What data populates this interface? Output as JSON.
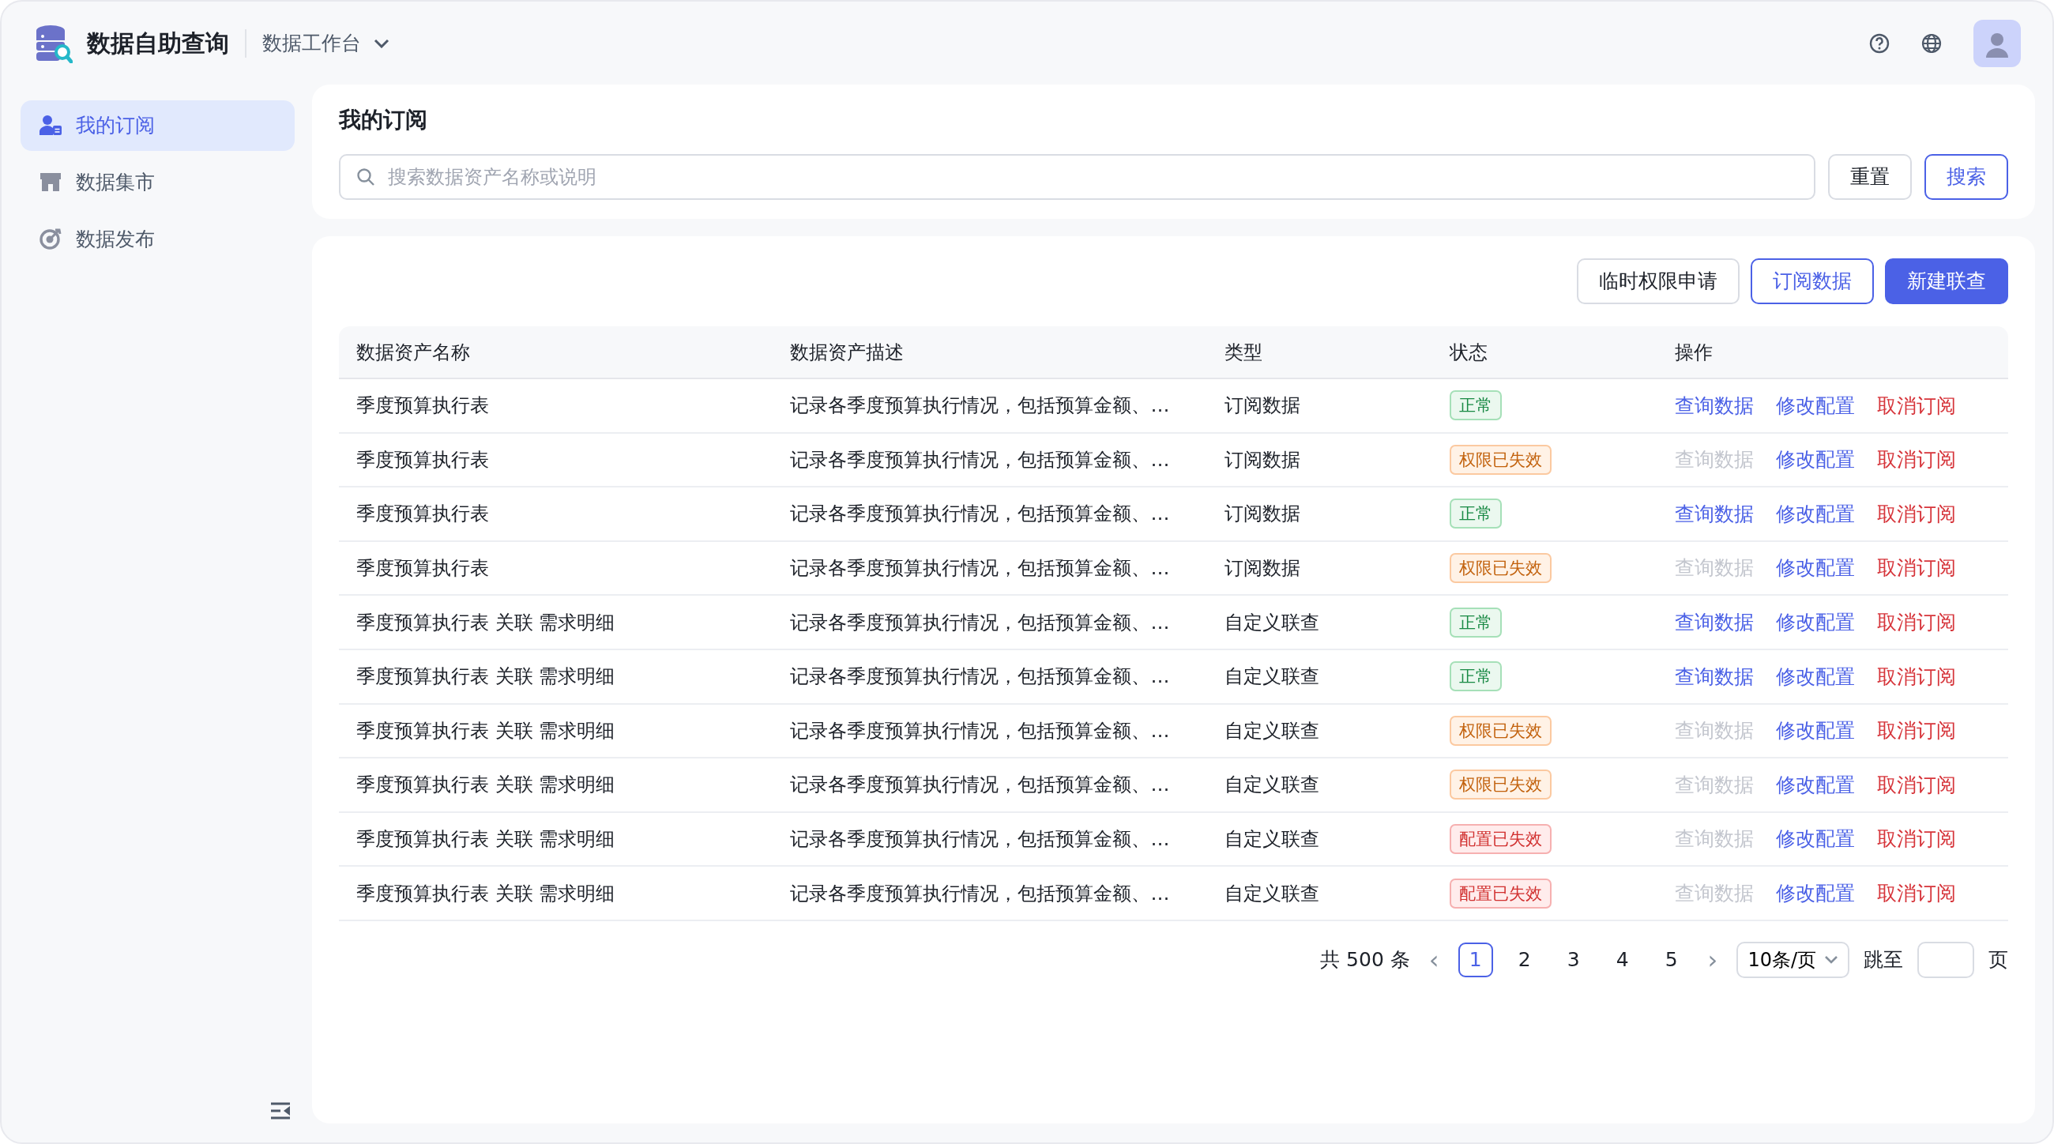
{
  "app": {
    "title": "数据自助查询",
    "workspace": "数据工作台"
  },
  "sidebar": {
    "items": [
      {
        "label": "我的订阅",
        "selected": true,
        "kind": "subscribe"
      },
      {
        "label": "数据集市",
        "selected": false,
        "kind": "market"
      },
      {
        "label": "数据发布",
        "selected": false,
        "kind": "publish"
      }
    ]
  },
  "search_panel": {
    "title": "我的订阅",
    "placeholder": "搜索数据资产名称或说明",
    "buttons": [
      {
        "label": "重置",
        "kind": "default"
      },
      {
        "label": "搜索",
        "kind": "outline"
      }
    ]
  },
  "toolbar": {
    "buttons": [
      {
        "label": "临时权限申请",
        "kind": "default"
      },
      {
        "label": "订阅数据",
        "kind": "outline"
      },
      {
        "label": "新建联查",
        "kind": "primary"
      }
    ]
  },
  "table": {
    "columns": [
      "数据资产名称",
      "数据资产描述",
      "类型",
      "状态",
      "操作"
    ],
    "rows": [
      {
        "name": "季度预算执行表",
        "description": "记录各季度预算执行情况，包括预算金额、…",
        "type": "订阅数据",
        "status": {
          "label": "正常",
          "kind": "ok"
        },
        "actions": [
          {
            "label": "查询数据",
            "kind": "link",
            "disabled": false
          },
          {
            "label": "修改配置",
            "kind": "link",
            "disabled": false
          },
          {
            "label": "取消订阅",
            "kind": "danger",
            "disabled": false
          }
        ]
      },
      {
        "name": "季度预算执行表",
        "description": "记录各季度预算执行情况，包括预算金额、…",
        "type": "订阅数据",
        "status": {
          "label": "权限已失效",
          "kind": "warning"
        },
        "actions": [
          {
            "label": "查询数据",
            "kind": "link",
            "disabled": true
          },
          {
            "label": "修改配置",
            "kind": "link",
            "disabled": false
          },
          {
            "label": "取消订阅",
            "kind": "danger",
            "disabled": false
          }
        ]
      },
      {
        "name": "季度预算执行表",
        "description": "记录各季度预算执行情况，包括预算金额、…",
        "type": "订阅数据",
        "status": {
          "label": "正常",
          "kind": "ok"
        },
        "actions": [
          {
            "label": "查询数据",
            "kind": "link",
            "disabled": false
          },
          {
            "label": "修改配置",
            "kind": "link",
            "disabled": false
          },
          {
            "label": "取消订阅",
            "kind": "danger",
            "disabled": false
          }
        ]
      },
      {
        "name": "季度预算执行表",
        "description": "记录各季度预算执行情况，包括预算金额、…",
        "type": "订阅数据",
        "status": {
          "label": "权限已失效",
          "kind": "warning"
        },
        "actions": [
          {
            "label": "查询数据",
            "kind": "link",
            "disabled": true
          },
          {
            "label": "修改配置",
            "kind": "link",
            "disabled": false
          },
          {
            "label": "取消订阅",
            "kind": "danger",
            "disabled": false
          }
        ]
      },
      {
        "name": "季度预算执行表 关联 需求明细",
        "description": "记录各季度预算执行情况，包括预算金额、…",
        "type": "自定义联查",
        "status": {
          "label": "正常",
          "kind": "ok"
        },
        "actions": [
          {
            "label": "查询数据",
            "kind": "link",
            "disabled": false
          },
          {
            "label": "修改配置",
            "kind": "link",
            "disabled": false
          },
          {
            "label": "取消订阅",
            "kind": "danger",
            "disabled": false
          }
        ]
      },
      {
        "name": "季度预算执行表 关联 需求明细",
        "description": "记录各季度预算执行情况，包括预算金额、…",
        "type": "自定义联查",
        "status": {
          "label": "正常",
          "kind": "ok"
        },
        "actions": [
          {
            "label": "查询数据",
            "kind": "link",
            "disabled": false
          },
          {
            "label": "修改配置",
            "kind": "link",
            "disabled": false
          },
          {
            "label": "取消订阅",
            "kind": "danger",
            "disabled": false
          }
        ]
      },
      {
        "name": "季度预算执行表 关联 需求明细",
        "description": "记录各季度预算执行情况，包括预算金额、…",
        "type": "自定义联查",
        "status": {
          "label": "权限已失效",
          "kind": "warning"
        },
        "actions": [
          {
            "label": "查询数据",
            "kind": "link",
            "disabled": true
          },
          {
            "label": "修改配置",
            "kind": "link",
            "disabled": false
          },
          {
            "label": "取消订阅",
            "kind": "danger",
            "disabled": false
          }
        ]
      },
      {
        "name": "季度预算执行表 关联 需求明细",
        "description": "记录各季度预算执行情况，包括预算金额、…",
        "type": "自定义联查",
        "status": {
          "label": "权限已失效",
          "kind": "warning"
        },
        "actions": [
          {
            "label": "查询数据",
            "kind": "link",
            "disabled": true
          },
          {
            "label": "修改配置",
            "kind": "link",
            "disabled": false
          },
          {
            "label": "取消订阅",
            "kind": "danger",
            "disabled": false
          }
        ]
      },
      {
        "name": "季度预算执行表 关联 需求明细",
        "description": "记录各季度预算执行情况，包括预算金额、…",
        "type": "自定义联查",
        "status": {
          "label": "配置已失效",
          "kind": "error"
        },
        "actions": [
          {
            "label": "查询数据",
            "kind": "link",
            "disabled": true
          },
          {
            "label": "修改配置",
            "kind": "link",
            "disabled": false
          },
          {
            "label": "取消订阅",
            "kind": "danger",
            "disabled": false
          }
        ]
      },
      {
        "name": "季度预算执行表 关联 需求明细",
        "description": "记录各季度预算执行情况，包括预算金额、…",
        "type": "自定义联查",
        "status": {
          "label": "配置已失效",
          "kind": "error"
        },
        "actions": [
          {
            "label": "查询数据",
            "kind": "link",
            "disabled": true
          },
          {
            "label": "修改配置",
            "kind": "link",
            "disabled": false
          },
          {
            "label": "取消订阅",
            "kind": "danger",
            "disabled": false
          }
        ]
      }
    ]
  },
  "pagination": {
    "total": "共 500 条",
    "prev": "‹",
    "pages": [
      {
        "label": "1",
        "selected": true
      },
      {
        "label": "2",
        "selected": false
      },
      {
        "label": "3",
        "selected": false
      },
      {
        "label": "4",
        "selected": false
      },
      {
        "label": "5",
        "selected": false
      }
    ],
    "next": "›",
    "page_size": "10条/页",
    "jump_label": "跳至",
    "page_suffix": "页"
  }
}
